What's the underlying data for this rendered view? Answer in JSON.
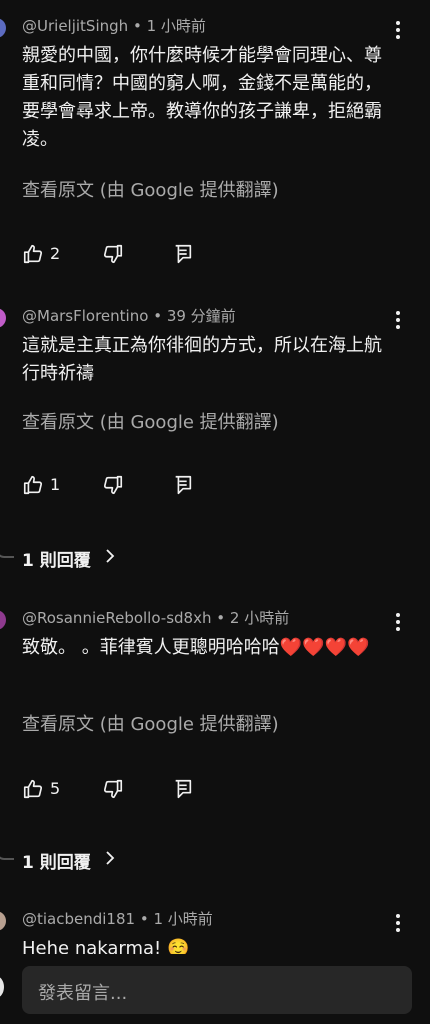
{
  "comments": [
    {
      "author": "@UrieljitSingh",
      "time": "1 小時前",
      "avatar_color": "#5c6bc0",
      "text": "親愛的中國，你什麼時候才能學會同理心、尊重和同情？中國的窮人啊，金錢不是萬能的，要學會尋求上帝。教導你的孩子謙卑，拒絕霸凌。",
      "translate": "查看原文 (由 Google 提供翻譯)",
      "likes": "2"
    },
    {
      "author": "@MarsFlorentino",
      "time": "39 分鐘前",
      "avatar_color": "#c05cc8",
      "text": "這就是主真正為你徘徊的方式，所以在海上航行時祈禱",
      "translate": "查看原文 (由 Google 提供翻譯)",
      "likes": "1",
      "replies": "1 則回覆"
    },
    {
      "author": "@RosannieRebollo-sd8xh",
      "time": "2 小時前",
      "avatar_color": "#8e3a8e",
      "text": "致敬。 。菲律賓人更聰明哈哈哈",
      "hearts": "❤️❤️❤️❤️",
      "translate": "查看原文 (由 Google 提供翻譯)",
      "likes": "5",
      "replies": "1 則回覆"
    },
    {
      "author": "@tiacbendi181",
      "time": "1 小時前",
      "avatar_color": "#b8a090",
      "text": "Hehe nakarma! ☺️"
    }
  ],
  "separator": "•",
  "input": {
    "placeholder": "發表留言..."
  },
  "icons": [
    "like-icon",
    "dislike-icon",
    "reply-icon",
    "more-vert-icon",
    "chevron-right-icon"
  ]
}
